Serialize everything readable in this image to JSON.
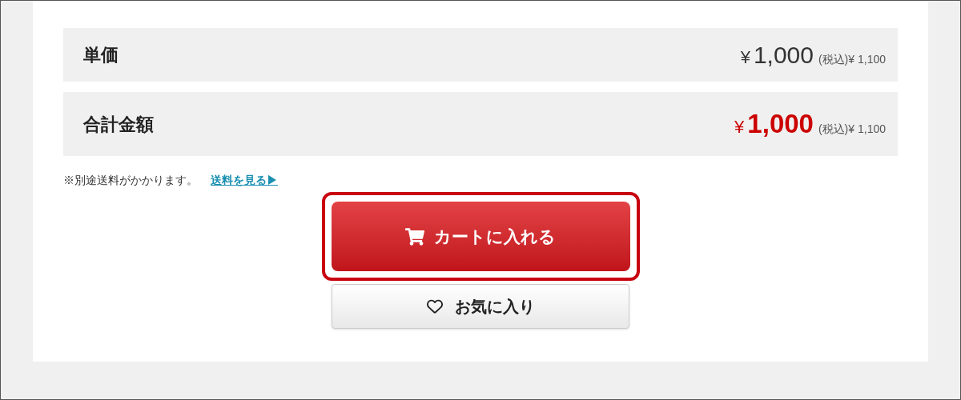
{
  "price_rows": [
    {
      "label": "単価",
      "currency": "¥",
      "amount": "1,000",
      "tax_included": "(税込)¥ 1,100",
      "emphasized": false
    },
    {
      "label": "合計金額",
      "currency": "¥",
      "amount": "1,000",
      "tax_included": "(税込)¥ 1,100",
      "emphasized": true
    }
  ],
  "shipping_note": {
    "text": "※別途送料がかかります。",
    "link": "送料を見る▶"
  },
  "cart_button": {
    "label": "カートに入れる",
    "highlighted": true
  },
  "favorite_button": {
    "label": "お気に入り"
  }
}
